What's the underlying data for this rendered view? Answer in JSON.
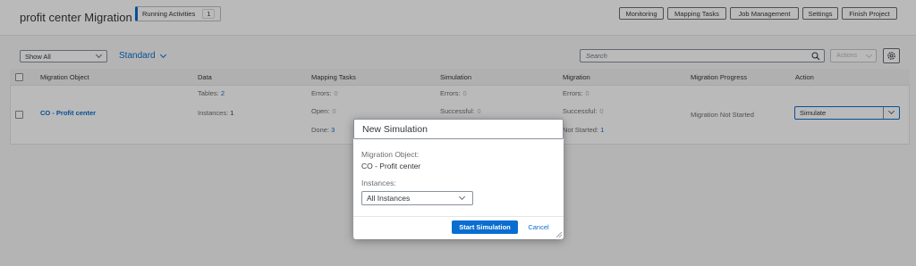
{
  "header": {
    "title": "profit center Migration",
    "running_label": "Running Activities",
    "running_count": "1",
    "buttons": [
      "Monitoring",
      "Mapping Tasks",
      "Job Management",
      "Settings",
      "Finish Project"
    ]
  },
  "toolbar": {
    "filter_value": "Show All",
    "variant": "Standard",
    "search_placeholder": "Search",
    "actions_label": "Actions"
  },
  "table": {
    "columns": [
      "Migration Object",
      "Data",
      "Mapping Tasks",
      "Simulation",
      "Migration",
      "Migration Progress",
      "Action"
    ],
    "row": {
      "object": "CO - Profit center",
      "tables_label": "Tables:",
      "tables_value": "2",
      "instances_label": "Instances:",
      "instances_value": "1",
      "mapping_errors_label": "Errors:",
      "mapping_errors_value": "0",
      "mapping_open_label": "Open:",
      "mapping_open_value": "0",
      "mapping_done_label": "Done:",
      "mapping_done_value": "3",
      "sim_errors_label": "Errors:",
      "sim_errors_value": "0",
      "sim_success_label": "Successful:",
      "sim_success_value": "0",
      "mig_errors_label": "Errors:",
      "mig_errors_value": "0",
      "mig_success_label": "Successful:",
      "mig_success_value": "0",
      "mig_notstarted_label": "Not Started:",
      "mig_notstarted_value": "1",
      "progress": "Migration Not Started",
      "action_value": "Simulate"
    }
  },
  "dialog": {
    "title": "New Simulation",
    "object_label": "Migration Object:",
    "object_value": "CO - Profit center",
    "instances_label": "Instances:",
    "instances_value": "All Instances",
    "start_button": "Start Simulation",
    "cancel_button": "Cancel"
  },
  "colors": {
    "accent": "#0a6ed1",
    "overlay": "rgba(0,0,0,0.27)"
  }
}
